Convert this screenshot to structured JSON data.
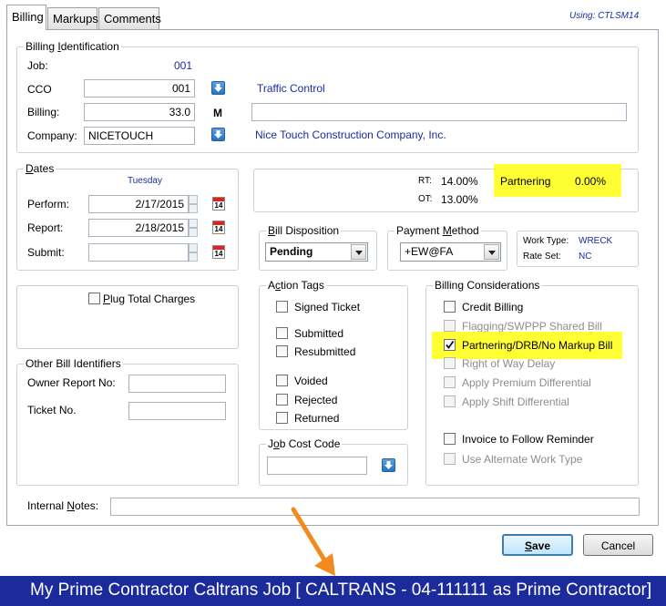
{
  "tabs": {
    "billing": "Billing",
    "markups": "Markups",
    "comments": "Comments"
  },
  "using": "Using: CTLSM14",
  "billing_identification": {
    "legend_pre": "Billing ",
    "legend_u": "I",
    "legend_post": "dentification",
    "job_label": "Job:",
    "job_value": "001",
    "cco_label": "CCO",
    "cco_value": "001",
    "cco_desc": "Traffic Control",
    "billing_label": "Billing:",
    "billing_value": "33.0",
    "billing_flag": "M",
    "billing_desc": "",
    "company_label": "Company:",
    "company_value": "NICETOUCH",
    "company_desc": "Nice Touch Construction Company, Inc."
  },
  "dates": {
    "legend_u": "D",
    "legend_post": "ates",
    "day": "Tuesday",
    "perform_label": "Perform:",
    "perform_value": "2/17/2015",
    "report_label": "Report:",
    "report_value": "2/18/2015",
    "submit_label": "Submit:",
    "submit_value": "",
    "cal_num": "14"
  },
  "rates": {
    "rt_label": "RT:",
    "rt_value": "14.00%",
    "ot_label": "OT:",
    "ot_value": "13.00%",
    "partnering_label": "Partnering",
    "partnering_value": "0.00%"
  },
  "bill_disposition": {
    "legend_u": "B",
    "legend_post": "ill Disposition",
    "value": "Pending"
  },
  "payment_method": {
    "legend_pre": "Payment ",
    "legend_u": "M",
    "legend_post": "ethod",
    "value": "+EW@FA"
  },
  "work_info": {
    "work_type_label": "Work Type:",
    "work_type_value": "WRECK",
    "rate_set_label": "Rate Set:",
    "rate_set_value": "NC"
  },
  "plug_total": {
    "label_u": "P",
    "label_post": "lug Total Charges"
  },
  "action_tags": {
    "legend_pre": "A",
    "legend_u": "c",
    "legend_post": "tion Tags",
    "items": [
      "Signed Ticket",
      "Submitted",
      "Resubmitted",
      "Voided",
      "Rejected",
      "Returned"
    ]
  },
  "billing_considerations": {
    "legend": "Billing Considerations",
    "items": [
      "Credit Billing",
      "Flagging/SWPPP Shared Bill",
      "Partnering/DRB/No Markup Bill",
      "Right of Way Delay",
      "Apply Premium Differential",
      "Apply Shift Differential",
      "Invoice to Follow Reminder",
      "Use Alternate Work Type"
    ]
  },
  "other_bill": {
    "legend": "Other Bill Identifiers",
    "owner_label": "Owner Report No:",
    "owner_value": "",
    "ticket_label": "Ticket No.",
    "ticket_value": ""
  },
  "job_cost": {
    "legend_pre": "J",
    "legend_u": "o",
    "legend_post": "b Cost Code",
    "value": ""
  },
  "internal_notes": {
    "label_pre": "Internal ",
    "label_u": "N",
    "label_post": "otes:",
    "value": ""
  },
  "buttons": {
    "save_u": "S",
    "save_post": "ave",
    "cancel": "Cancel"
  },
  "footer": "My Prime Contractor Caltrans Job  [ CALTRANS - 04-111111 as Prime Contractor]",
  "colors": {
    "highlight": "#ffff33",
    "footer_bg": "#1b2b9c",
    "link_blue": "#1a2ea0",
    "arrow": "#f28a1e"
  }
}
